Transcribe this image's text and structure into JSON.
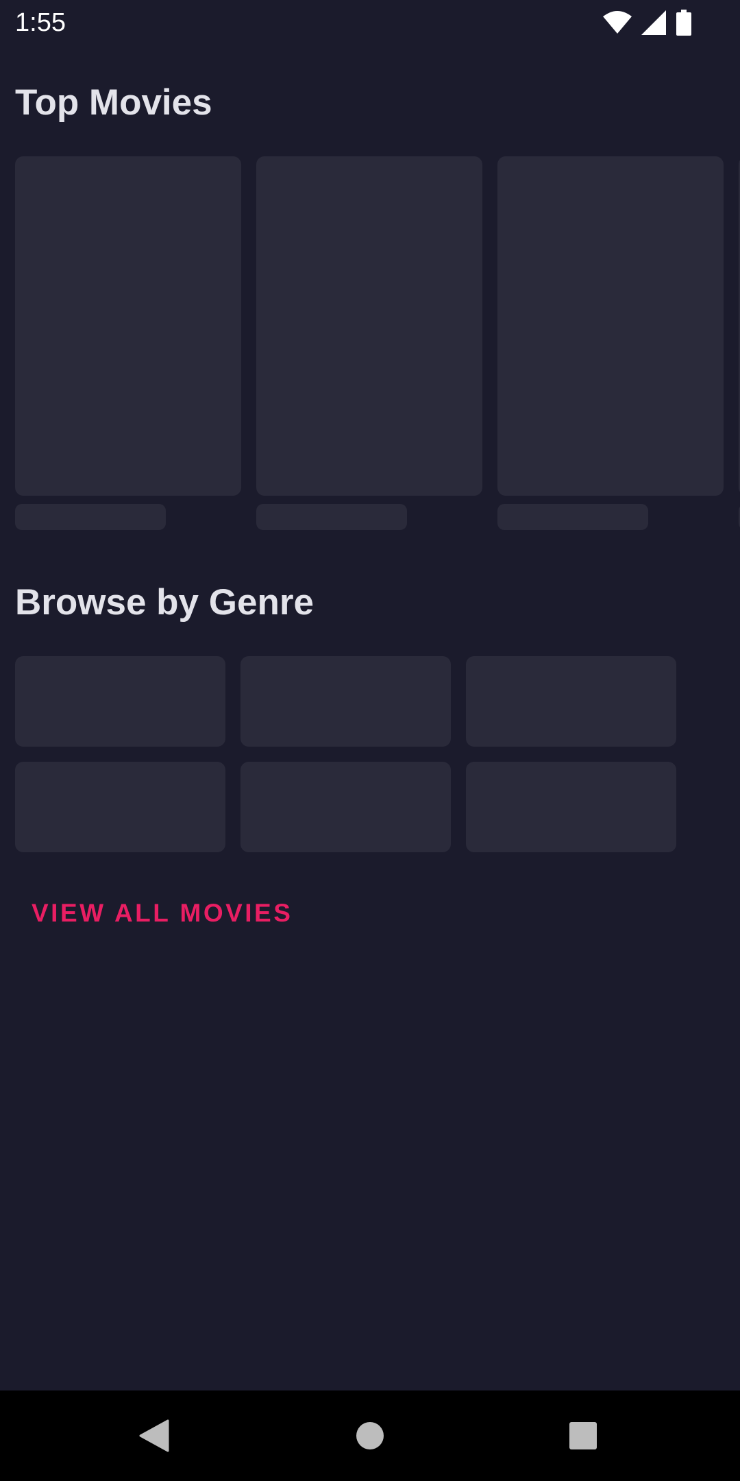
{
  "status_bar": {
    "time": "1:55",
    "icons": [
      "wifi-icon",
      "cell-signal-icon",
      "battery-icon"
    ]
  },
  "sections": {
    "top_movies": {
      "title": "Top Movies",
      "loading_placeholders": 3
    },
    "browse_by_genre": {
      "title": "Browse by Genre",
      "loading_placeholders": 6
    }
  },
  "actions": {
    "view_all_label": "VIEW ALL MOVIES"
  },
  "nav_bar": {
    "buttons": [
      "back-icon",
      "home-icon",
      "recents-icon"
    ]
  },
  "colors": {
    "background": "#1b1b2c",
    "placeholder": "#2a2a3a",
    "accent": "#e91e63",
    "title_text": "#e3e3ea"
  }
}
